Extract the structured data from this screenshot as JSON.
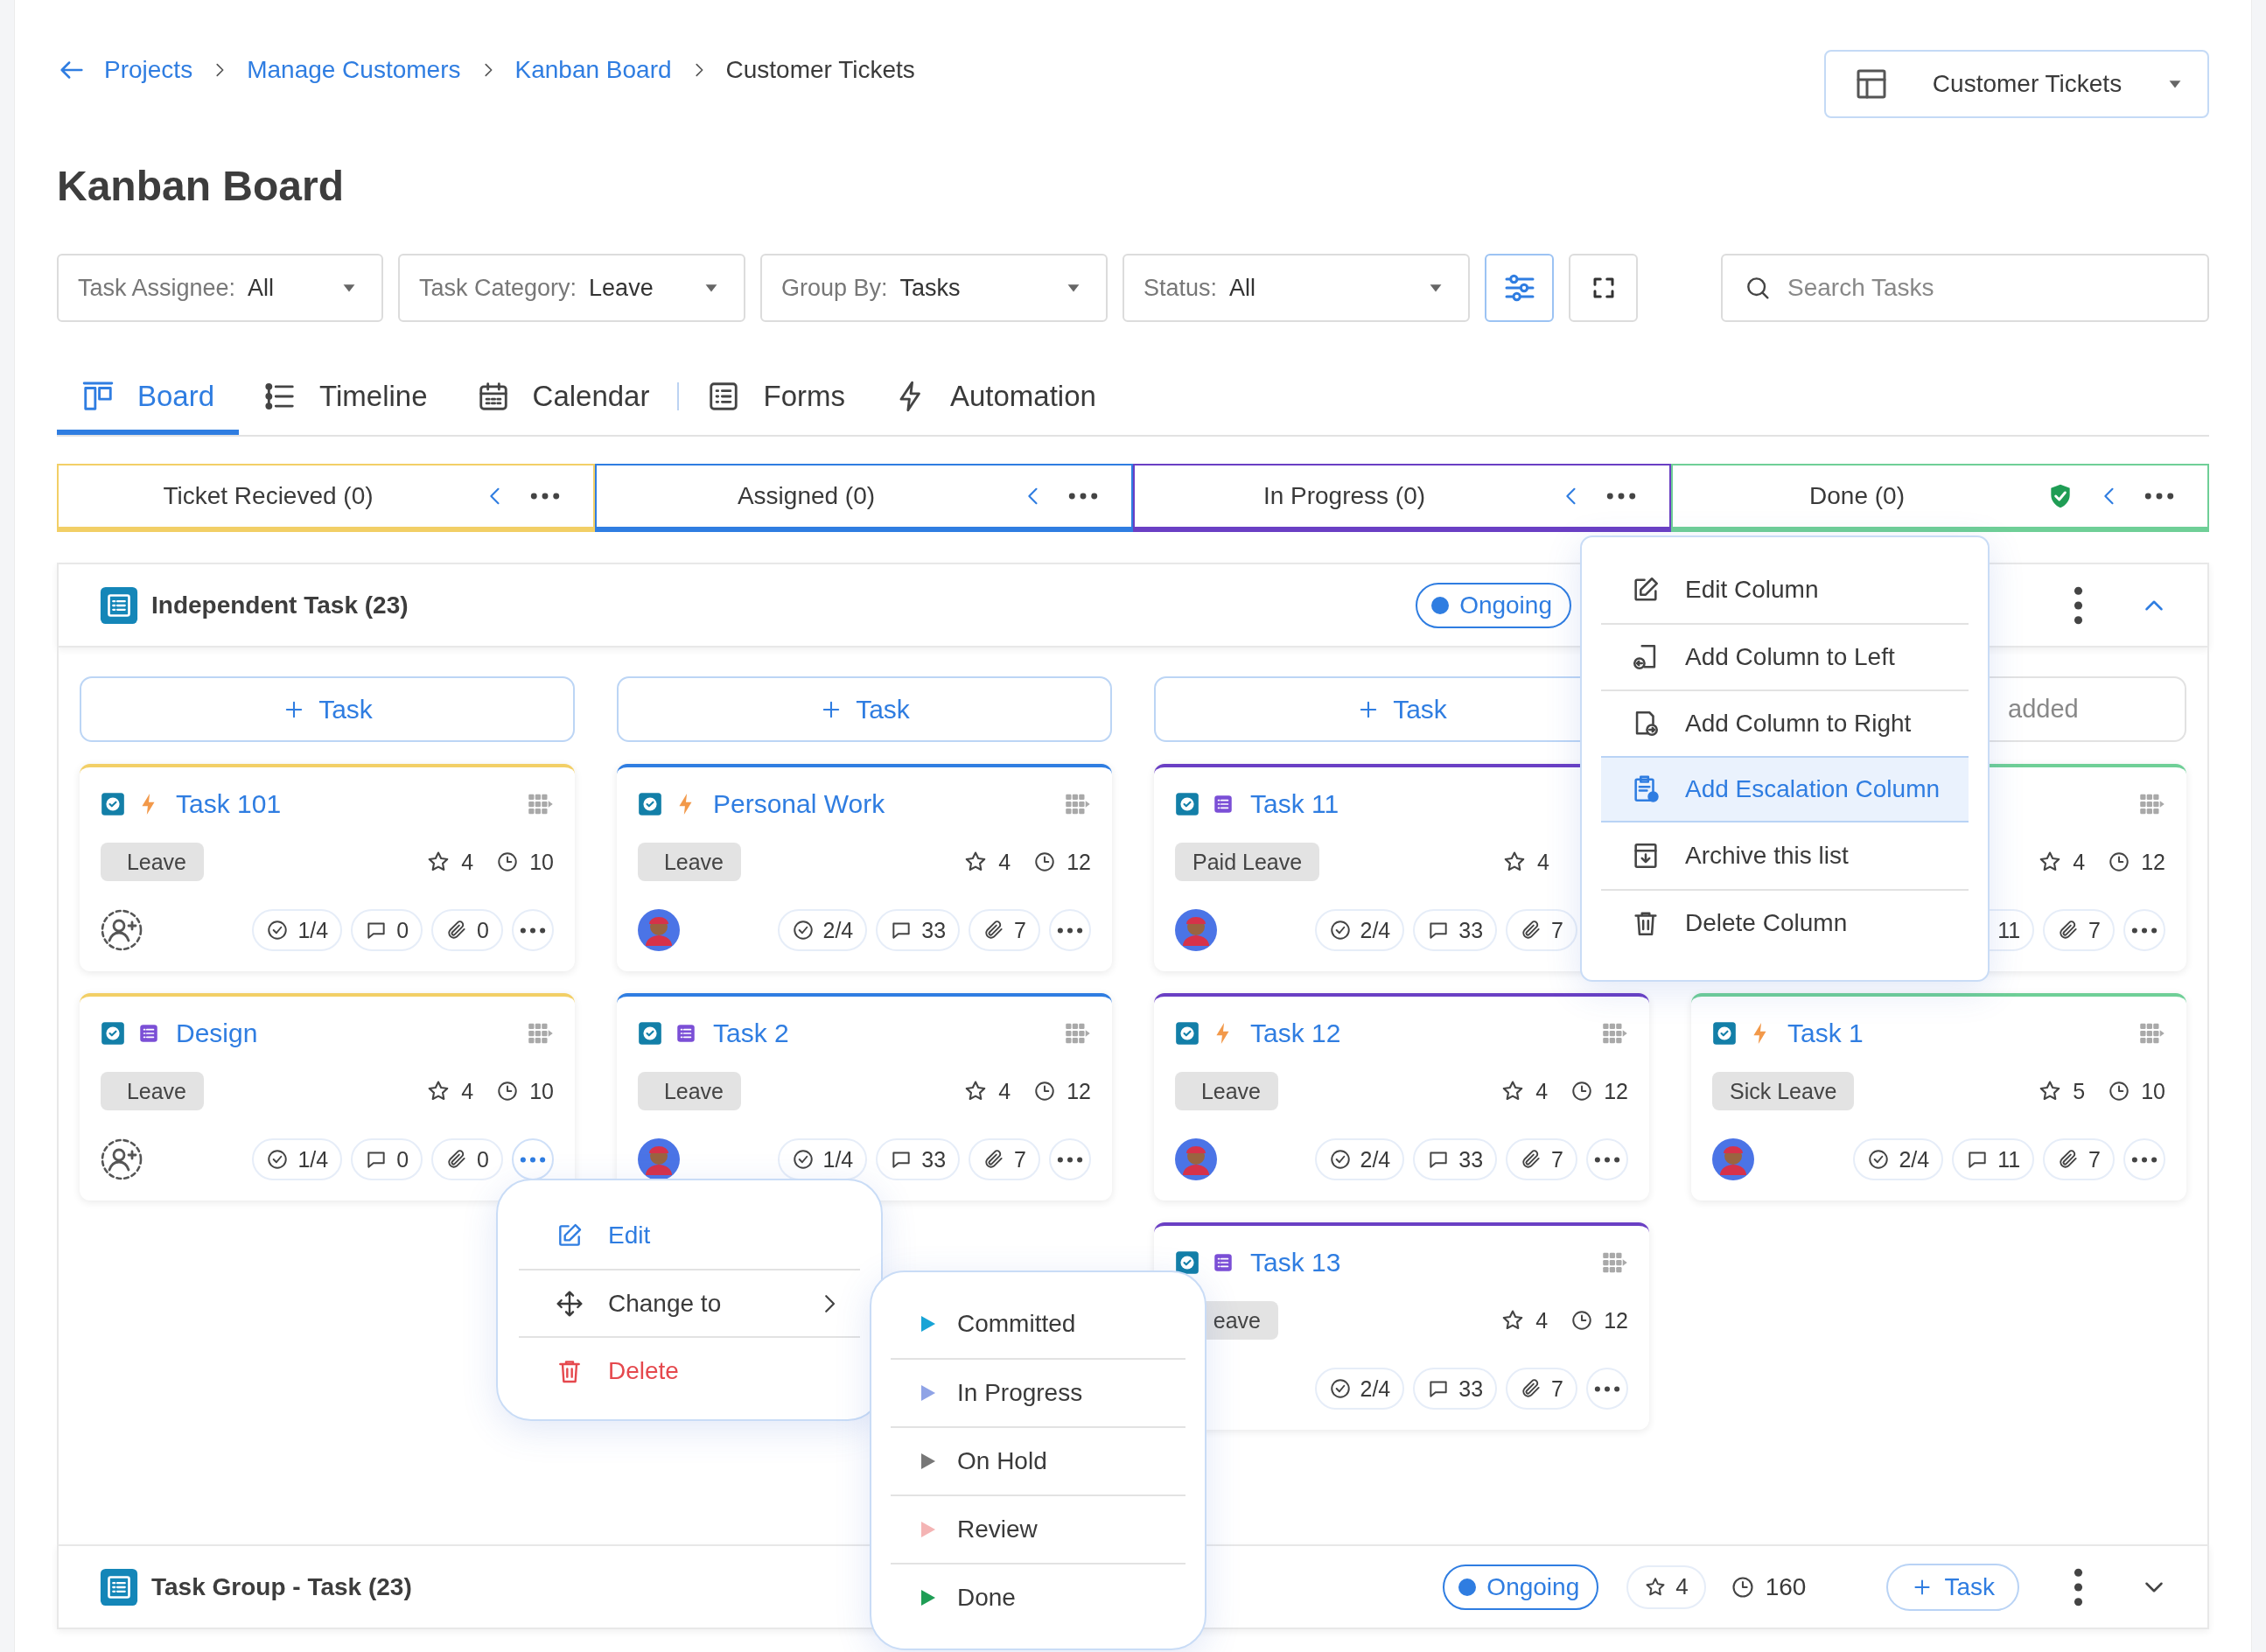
{
  "breadcrumb": [
    {
      "label": "Projects",
      "current": false
    },
    {
      "label": "Manage Customers",
      "current": false
    },
    {
      "label": "Kanban Board",
      "current": false
    },
    {
      "label": "Customer Tickets",
      "current": true
    }
  ],
  "view_selector": {
    "value": "Customer Tickets"
  },
  "title": "Kanban Board",
  "filters": [
    {
      "label": "Task Assignee:",
      "value": "All"
    },
    {
      "label": "Task Category:",
      "value": "Leave"
    },
    {
      "label": "Group By:",
      "value": "Tasks"
    },
    {
      "label": "Status:",
      "value": "All"
    }
  ],
  "filter_button": {
    "active": true
  },
  "search": {
    "placeholder": "Search Tasks"
  },
  "tabs": [
    {
      "label": "Board",
      "kind": "board",
      "selected": true,
      "separated": false
    },
    {
      "label": "Timeline",
      "kind": "timeline",
      "selected": false,
      "separated": false
    },
    {
      "label": "Calendar",
      "kind": "calendar",
      "selected": false,
      "separated": false
    },
    {
      "label": "Forms",
      "kind": "forms",
      "selected": false,
      "separated": true
    },
    {
      "label": "Automation",
      "kind": "automation",
      "selected": false,
      "separated": false
    }
  ],
  "columns": [
    {
      "title": "Ticket Recieved (0)",
      "color": "#f2cf66",
      "verified": false
    },
    {
      "title": "Assigned (0)",
      "color": "#2f7de1",
      "verified": false
    },
    {
      "title": "In Progress (0)",
      "color": "#6a3fc4",
      "verified": false
    },
    {
      "title": "Done (0)",
      "color": "#6fcf97",
      "verified": true
    }
  ],
  "groups": [
    {
      "title": "Independent Task (23)",
      "status": "Ongoing",
      "expanded": true,
      "lanes": [
        {
          "add_label": "Task",
          "cards": [
            {
              "title": "Task 101",
              "kind": "bolt",
              "tag": "Leave",
              "star_count": "4",
              "time": "10",
              "assigned": false,
              "subtasks": "1/4",
              "comments": "0",
              "attachments": "0",
              "more": {
                "open": false
              }
            },
            {
              "title": "Design",
              "kind": "form",
              "tag": "Leave",
              "star_count": "4",
              "time": "10",
              "assigned": false,
              "subtasks": "1/4",
              "comments": "0",
              "attachments": "0",
              "more": {
                "open": true
              }
            }
          ]
        },
        {
          "add_label": "Task",
          "cards": [
            {
              "title": "Personal Work",
              "kind": "bolt",
              "tag": "Leave",
              "star_count": "4",
              "time": "12",
              "assigned": true,
              "subtasks": "2/4",
              "comments": "33",
              "attachments": "7",
              "more": {
                "open": false
              }
            },
            {
              "title": "Task 2",
              "kind": "form",
              "tag": "Leave",
              "star_count": "4",
              "time": "12",
              "assigned": true,
              "subtasks": "1/4",
              "comments": "33",
              "attachments": "7",
              "more": {
                "open": false
              }
            }
          ]
        },
        {
          "add_label": "Task",
          "cards": [
            {
              "title": "Task 11",
              "kind": "form",
              "tag": "Paid Leave",
              "star_count": "4",
              "assigned": true,
              "subtasks": "2/4",
              "comments": "33",
              "attachments": "7"
            },
            {
              "title": "Task 12",
              "kind": "bolt",
              "tag": "Leave",
              "star_count": "4",
              "time": "12",
              "assigned": true,
              "subtasks": "2/4",
              "comments": "33",
              "attachments": "7",
              "more": {
                "open": false
              }
            },
            {
              "title": "Task 13",
              "kind": "form",
              "tag": "eave",
              "star_count": "4",
              "time": "12",
              "subtasks": "2/4",
              "comments": "33",
              "attachments": "7",
              "more": {
                "open": false
              }
            }
          ]
        },
        {
          "empty_note": "added",
          "cards": [
            {
              "star_count": "4",
              "time": "12",
              "comments": "11",
              "attachments": "7",
              "more": {
                "open": false
              }
            },
            {
              "title": "Task 1",
              "kind": "bolt",
              "tag": "Sick Leave",
              "star_count": "5",
              "time": "10",
              "assigned": true,
              "subtasks": "2/4",
              "comments": "11",
              "attachments": "7",
              "more": {
                "open": false
              }
            }
          ]
        }
      ]
    },
    {
      "title": "Task Group - Task (23)",
      "status": "Ongoing",
      "expanded": false,
      "star_count": "4",
      "time": "160",
      "add_label": "Task"
    }
  ],
  "column_menu": {
    "items": [
      {
        "label": "Edit Column",
        "kind": "edit",
        "selected": false
      },
      {
        "label": "Add Column to Left",
        "kind": "add-left",
        "selected": false
      },
      {
        "label": "Add Column to Right",
        "kind": "add-right",
        "selected": false
      },
      {
        "label": "Add Escalation Column",
        "kind": "escalate",
        "selected": true
      },
      {
        "label": "Archive this list",
        "kind": "archive",
        "selected": false
      },
      {
        "label": "Delete Column",
        "kind": "delete",
        "selected": false
      }
    ]
  },
  "card_menu": {
    "items": [
      {
        "label": "Edit",
        "kind": "edit"
      },
      {
        "label": "Change to",
        "kind": "change"
      },
      {
        "label": "Delete",
        "kind": "delete"
      }
    ]
  },
  "status_menu": {
    "items": [
      {
        "label": "Committed",
        "color": "#17a4d6"
      },
      {
        "label": "In Progress",
        "color": "#8fa3e6"
      },
      {
        "label": "On Hold",
        "color": "#777777"
      },
      {
        "label": "Review",
        "color": "#f4b4b4"
      },
      {
        "label": "Done",
        "color": "#1f9d55"
      }
    ]
  }
}
